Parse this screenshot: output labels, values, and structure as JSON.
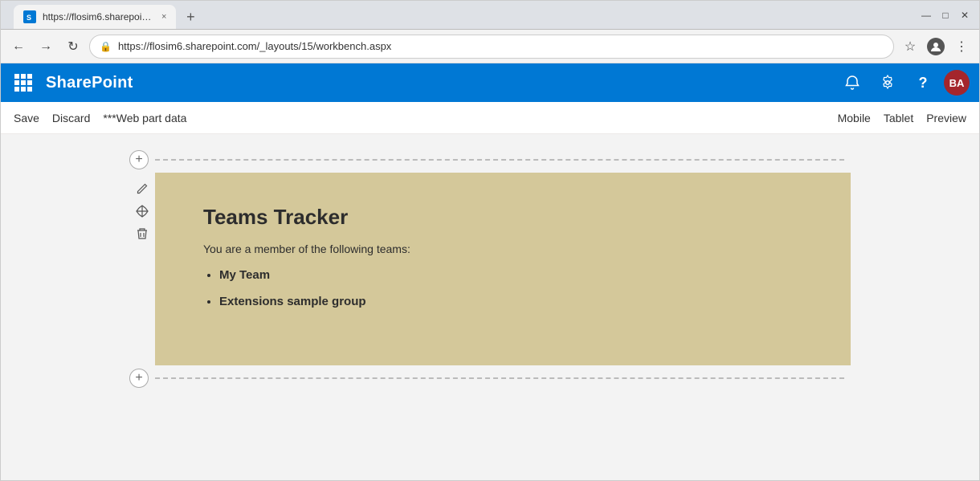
{
  "browser": {
    "tab_title": "https://flosim6.sharepoint.com/...",
    "tab_favicon_label": "SP",
    "address": "https://flosim6.sharepoint.com/_layouts/15/workbench.aspx",
    "new_tab_icon": "+",
    "close_tab_icon": "×",
    "back_icon": "←",
    "forward_icon": "→",
    "refresh_icon": "↻",
    "lock_icon": "🔒",
    "star_icon": "☆",
    "profile_icon": "👤",
    "menu_icon": "⋮",
    "minimize_icon": "—",
    "maximize_icon": "□",
    "close_icon": "✕"
  },
  "sharepoint": {
    "app_name": "SharePoint",
    "waffle_label": "App launcher",
    "bell_icon": "🔔",
    "settings_icon": "⚙",
    "help_icon": "?",
    "avatar_initials": "BA"
  },
  "toolbar": {
    "save_label": "Save",
    "discard_label": "Discard",
    "webpart_data_label": "***Web part data",
    "mobile_label": "Mobile",
    "tablet_label": "Tablet",
    "preview_label": "Preview"
  },
  "canvas": {
    "add_section_top_icon": "+",
    "add_section_bottom_icon": "+",
    "webpart_edit_icon": "✏",
    "webpart_move_icon": "⊕",
    "webpart_delete_icon": "🗑"
  },
  "teams_tracker": {
    "title": "Teams Tracker",
    "subtitle": "You are a member of the following teams:",
    "teams": [
      {
        "name": "My Team"
      },
      {
        "name": "Extensions sample group"
      }
    ]
  }
}
